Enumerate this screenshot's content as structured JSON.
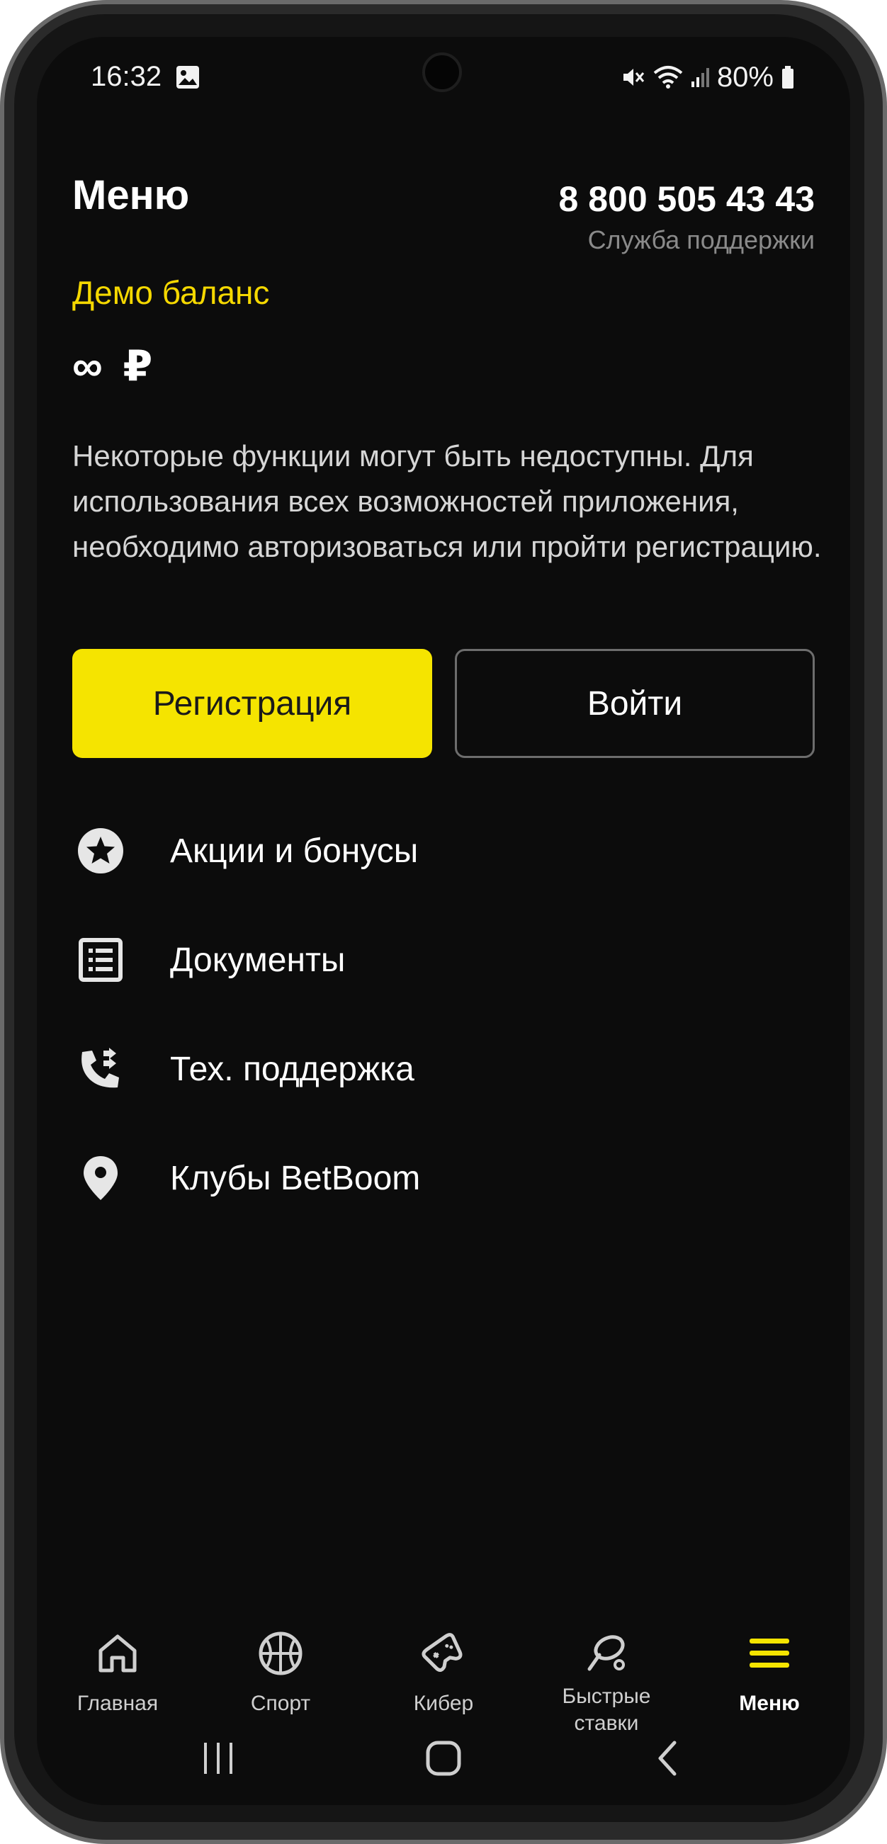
{
  "status_bar": {
    "time": "16:32",
    "battery": "80%",
    "icons": [
      "image-icon",
      "mute-icon",
      "wifi-icon",
      "signal-icon",
      "battery-icon"
    ]
  },
  "header": {
    "title": "Меню",
    "support_phone": "8 800 505 43 43",
    "support_label": "Служба поддержки"
  },
  "balance": {
    "label": "Демо баланс",
    "value": "∞ ₽"
  },
  "info_text": "Некоторые функции могут быть недоступны. Для использования всех возможностей приложения, необходимо авторизоваться или пройти регистрацию.",
  "buttons": {
    "register_label": "Регистрация",
    "login_label": "Войти"
  },
  "menu_items": [
    {
      "label": "Акции и бонусы",
      "icon": "star-badge-icon"
    },
    {
      "label": "Документы",
      "icon": "document-list-icon"
    },
    {
      "label": "Тех. поддержка",
      "icon": "phone-forward-icon"
    },
    {
      "label": "Клубы BetBoom",
      "icon": "location-pin-icon"
    }
  ],
  "bottom_nav": [
    {
      "label": "Главная",
      "icon": "home-icon",
      "active": false
    },
    {
      "label": "Спорт",
      "icon": "basketball-icon",
      "active": false
    },
    {
      "label": "Кибер",
      "icon": "gamepad-icon",
      "active": false
    },
    {
      "label": "Быстрые\nставки",
      "icon": "quick-bet-icon",
      "active": false
    },
    {
      "label": "Меню",
      "icon": "menu-icon",
      "active": true
    }
  ],
  "colors": {
    "accent": "#f5e400",
    "demo_label": "#f5d800",
    "background": "#0c0c0c",
    "muted": "#8a8a8a"
  }
}
